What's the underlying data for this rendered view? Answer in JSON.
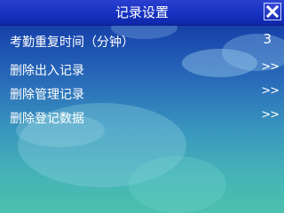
{
  "header": {
    "title": "记录设置",
    "close_icon": "close-icon"
  },
  "menu": {
    "items": [
      {
        "label": "考勤重复时间（分钟）",
        "value": "3"
      },
      {
        "label": "删除出入记录",
        "arrow": ">>"
      },
      {
        "label": "删除管理记录",
        "arrow": ">>"
      },
      {
        "label": "删除登记数据",
        "arrow": ">>"
      }
    ]
  },
  "colors": {
    "titlebar": "#1530bf",
    "background_top": "#0e2f9c",
    "background_bottom": "#4cc0ae",
    "text": "#ffffff"
  }
}
